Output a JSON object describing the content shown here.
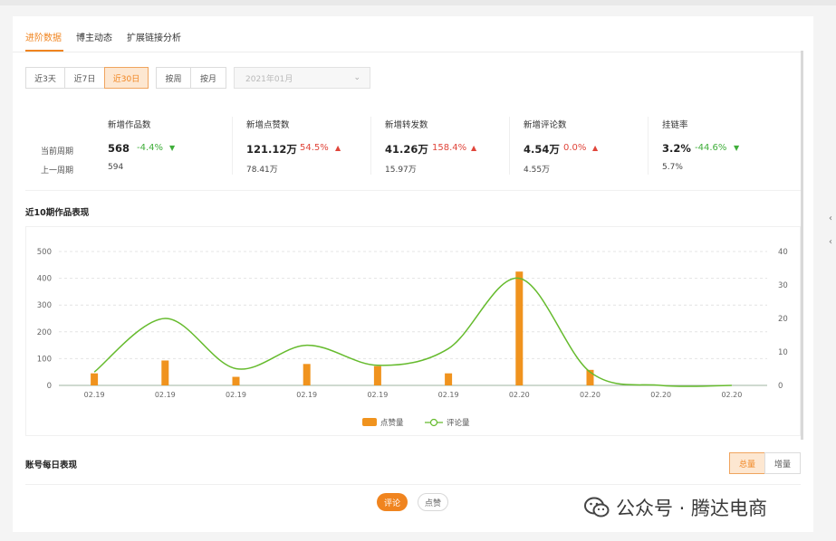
{
  "tabs": [
    {
      "label": "进阶数据",
      "active": true
    },
    {
      "label": "博主动态",
      "active": false
    },
    {
      "label": "扩展链接分析",
      "active": false
    }
  ],
  "filters": {
    "ranges": [
      {
        "label": "近3天",
        "active": false
      },
      {
        "label": "近7日",
        "active": false
      },
      {
        "label": "近30日",
        "active": true
      }
    ],
    "periods": [
      {
        "label": "按周",
        "active": false
      },
      {
        "label": "按月",
        "active": false
      }
    ],
    "month_select": {
      "value": "2021年01月"
    }
  },
  "stats": {
    "current_label": "当前周期",
    "previous_label": "上一周期",
    "metrics": [
      {
        "name": "新增作品数",
        "current": "568",
        "change": "-4.4%",
        "direction": "down",
        "previous": "594"
      },
      {
        "name": "新增点赞数",
        "current": "121.12万",
        "change": "54.5%",
        "direction": "up",
        "previous": "78.41万"
      },
      {
        "name": "新增转发数",
        "current": "41.26万",
        "change": "158.4%",
        "direction": "up",
        "previous": "15.97万"
      },
      {
        "name": "新增评论数",
        "current": "4.54万",
        "change": "0.0%",
        "direction": "up",
        "previous": "4.55万"
      },
      {
        "name": "挂链率",
        "current": "3.2%",
        "change": "-44.6%",
        "direction": "down",
        "previous": "5.7%"
      }
    ]
  },
  "chart_section": {
    "title": "近10期作品表现"
  },
  "chart_data": {
    "type": "bar",
    "categories": [
      "02.19",
      "02.19",
      "02.19",
      "02.19",
      "02.19",
      "02.19",
      "02.20",
      "02.20",
      "02.20",
      "02.20"
    ],
    "series": [
      {
        "name": "点赞量",
        "type": "bar",
        "axis": "left",
        "values": [
          45,
          93,
          32,
          80,
          72,
          45,
          425,
          58,
          0,
          0
        ]
      },
      {
        "name": "评论量",
        "type": "line",
        "axis": "right",
        "values": [
          4,
          20,
          5,
          12,
          6,
          11,
          32,
          4,
          0,
          0
        ]
      }
    ],
    "y_left": {
      "ticks": [
        0,
        100,
        200,
        300,
        400,
        500
      ],
      "lim": [
        0,
        500
      ]
    },
    "y_right": {
      "ticks": [
        0,
        10,
        20,
        30,
        40
      ],
      "lim": [
        0,
        40
      ]
    },
    "legend": "bottom-center",
    "grid": true,
    "colors": {
      "bar": "#f0931e",
      "line": "#66bb2e"
    }
  },
  "daily_section": {
    "title": "账号每日表现",
    "toggles": [
      {
        "label": "总量",
        "active": true
      },
      {
        "label": "增量",
        "active": false
      }
    ],
    "pills": [
      {
        "label": "评论",
        "active": true
      },
      {
        "label": "点赞",
        "active": false
      }
    ]
  },
  "watermark": {
    "text": "公众号 · 腾达电商",
    "icon": "wechat-icon"
  },
  "colors": {
    "accent": "#f0841f",
    "up": "#e0453a",
    "down": "#3fae3a"
  }
}
